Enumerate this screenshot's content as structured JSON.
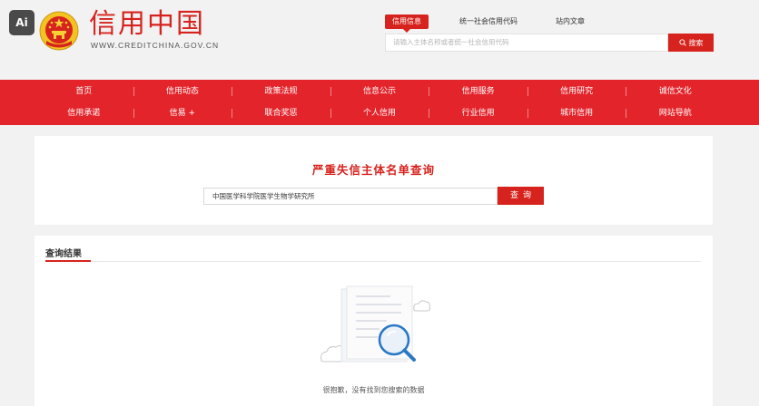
{
  "badge": {
    "text": "Ai"
  },
  "logo": {
    "title": "信用中国",
    "url": "WWW.CREDITCHINA.GOV.CN"
  },
  "header_search": {
    "tabs": [
      {
        "label": "信用信息",
        "active": true
      },
      {
        "label": "统一社会信用代码",
        "active": false
      },
      {
        "label": "站内文章",
        "active": false
      }
    ],
    "placeholder": "请输入主体名称或者统一社会信用代码",
    "button_label": "搜索"
  },
  "nav": {
    "row1": [
      "首页",
      "信用动态",
      "政策法规",
      "信息公示",
      "信用服务",
      "信用研究",
      "诚信文化"
    ],
    "row2": [
      "信用承诺",
      "信易 +",
      "联合奖惩",
      "个人信用",
      "行业信用",
      "城市信用",
      "网站导航"
    ]
  },
  "query": {
    "title": "严重失信主体名单查询",
    "input_value": "中国医学科学院医学生物学研究所",
    "button_label": "查询"
  },
  "results": {
    "title": "查询结果",
    "empty_message": "很抱歉，没有找到您搜索的数据"
  },
  "colors": {
    "brand_red": "#d7231e",
    "nav_red": "#e4242b",
    "search_blue": "#2a78c5"
  },
  "icons": {
    "emblem": "national-emblem-icon",
    "search": "search-icon",
    "empty": "empty-search-illustration"
  }
}
